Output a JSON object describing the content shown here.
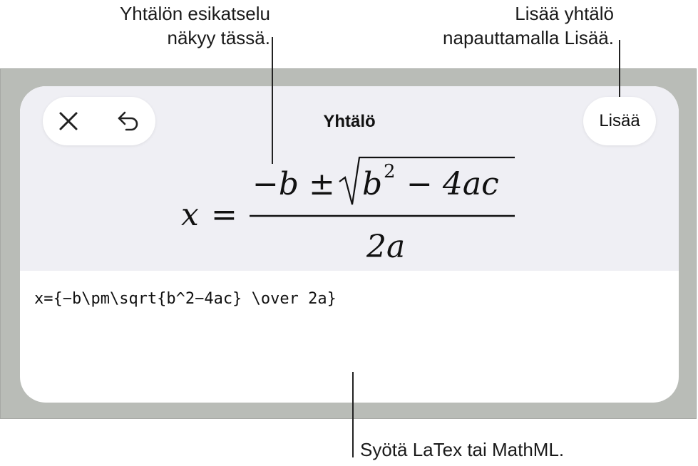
{
  "annotations": {
    "preview": [
      "Yhtälön esikatselu",
      "näkyy tässä."
    ],
    "insert": [
      "Lisää yhtälö",
      "napauttamalla Lisää."
    ],
    "input": "Syötä LaTex tai MathML."
  },
  "dialog": {
    "title": "Yhtälö",
    "insert_label": "Lisää",
    "close_icon": "close-icon",
    "undo_icon": "undo-icon"
  },
  "preview": {
    "lhs": "x",
    "equals": "=",
    "numerator_lead": "−b ±",
    "radicand_base": "b",
    "radicand_exp": "2",
    "radicand_tail": " − 4ac",
    "denominator": "2a"
  },
  "editor": {
    "latex": "x={−b\\pm\\sqrt{b^2−4ac} \\over 2a}"
  },
  "colors": {
    "backdrop": "#b9bcb7",
    "panel_top": "#efeff4",
    "panel": "#ffffff"
  }
}
